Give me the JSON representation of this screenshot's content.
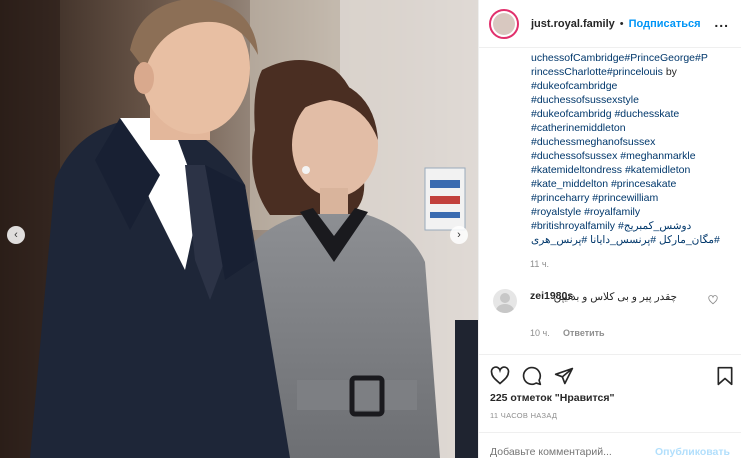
{
  "header": {
    "username": "just.royal.family",
    "separator": "•",
    "follow_label": "Подписаться",
    "more_label": "..."
  },
  "caption": {
    "lines": [
      "uchessofCambridge#PrinceGeorge#P",
      "rincessCharlotte#princelouis",
      "#dukeofcambridge",
      "#duchessofsussexstyle",
      "#dukeofcambridg #duchesskate",
      "#catherinemiddleton",
      "#duchessmeghanofsussex",
      "#duchessofsussex #meghanmarkle",
      "#katemideltondress #katemidleton",
      "#kate_middelton #princesakate",
      "#princeharry #princewilliam",
      "#royalstyle #royalfamily",
      "#britishroyalfamily #دوشس_کمبریج",
      "#مگان_مارکل #پرنسس_دایانا #پرنس_هری"
    ],
    "by_word": "by",
    "time": "11 ч."
  },
  "comment": {
    "username": "zei1980s",
    "text": "چقدر پیر و بی کلاس و بدتیپن",
    "time": "10 ч.",
    "reply_label": "Ответить"
  },
  "footer": {
    "likes": "225 отметок \"Нравится\"",
    "time_ago": "11 часов назад",
    "add_comment_placeholder": "Добавьте комментарий...",
    "publish_label": "Опубликовать"
  },
  "icons": {
    "like": "heart-icon",
    "comment": "comment-icon",
    "share": "share-icon",
    "save": "bookmark-icon",
    "comment_like": "heart-icon",
    "prev": "chevron-left-icon",
    "next": "chevron-right-icon"
  },
  "colors": {
    "link": "#00376b",
    "follow": "#0095f6",
    "publish_disabled": "#b2dffc",
    "muted": "#8e8e8e"
  }
}
